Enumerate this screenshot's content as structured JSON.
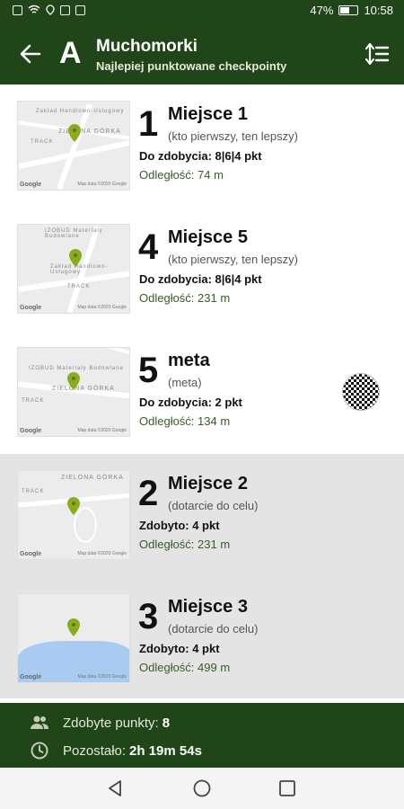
{
  "status_bar": {
    "battery": "47%",
    "battery_level": 0.47,
    "time": "10:58"
  },
  "app_bar": {
    "team_letter": "A",
    "title": "Muchomorki",
    "subtitle": "Najlepiej punktowane checkpointy",
    "back_icon": "arrow-left-icon",
    "sort_icon": "sort-icon"
  },
  "checkpoints": [
    {
      "number": "1",
      "name": "Miejsce 1",
      "type": "(kto pierwszy, ten lepszy)",
      "points_label": "Do zdobycia:",
      "points": "8|6|4 pkt",
      "distance_label": "Odległość:",
      "distance": "74 m",
      "done": false,
      "map_labels": [
        "Zakład Handlowo-Usługowy",
        "ZIELONA GÓRKA",
        "TRACK"
      ],
      "google": "Google",
      "map_data": "Map data ©2020 Google"
    },
    {
      "number": "4",
      "name": "Miejsce 5",
      "type": "(kto pierwszy, ten lepszy)",
      "points_label": "Do zdobycia:",
      "points": "8|6|4 pkt",
      "distance_label": "Odległość:",
      "distance": "231 m",
      "done": false,
      "map_labels": [
        "IZOBUD Materiały Budowlane",
        "Zakład Handlowo-Usługowy",
        "TRACK"
      ],
      "google": "Google",
      "map_data": "Map data ©2020 Google"
    },
    {
      "number": "5",
      "name": "meta",
      "type": "(meta)",
      "points_label": "Do zdobycia:",
      "points": "2 pkt",
      "distance_label": "Odległość:",
      "distance": "134 m",
      "done": false,
      "map_labels": [
        "IZOBUD Materiały Budowlane",
        "TRACK",
        "ZIELONA GÓRKA"
      ],
      "google": "Google",
      "map_data": "Map data ©2020 Google"
    },
    {
      "number": "2",
      "name": "Miejsce 2",
      "type": "(dotarcie do celu)",
      "points_label": "Zdobyto:",
      "points": "4 pkt",
      "distance_label": "Odległość:",
      "distance": "231 m",
      "done": true,
      "map_labels": [
        "ZIELONA GÓRKA",
        "TRACK"
      ],
      "google": "Google",
      "map_data": "Map data ©2020 Google"
    },
    {
      "number": "3",
      "name": "Miejsce 3",
      "type": "(dotarcie do celu)",
      "points_label": "Zdobyto:",
      "points": "4 pkt",
      "distance_label": "Odległość:",
      "distance": "499 m",
      "done": true,
      "map_labels": [],
      "google": "Google",
      "map_data": "Map data ©2020 Google"
    }
  ],
  "footer": {
    "points_label": "Zdobyte punkty:",
    "points_value": "8",
    "time_label": "Pozostało:",
    "time_value": "2h 19m 54s"
  },
  "colors": {
    "primary": "#1f4518",
    "pin": "#8bab1e",
    "done_bg": "#e4e4e4"
  }
}
